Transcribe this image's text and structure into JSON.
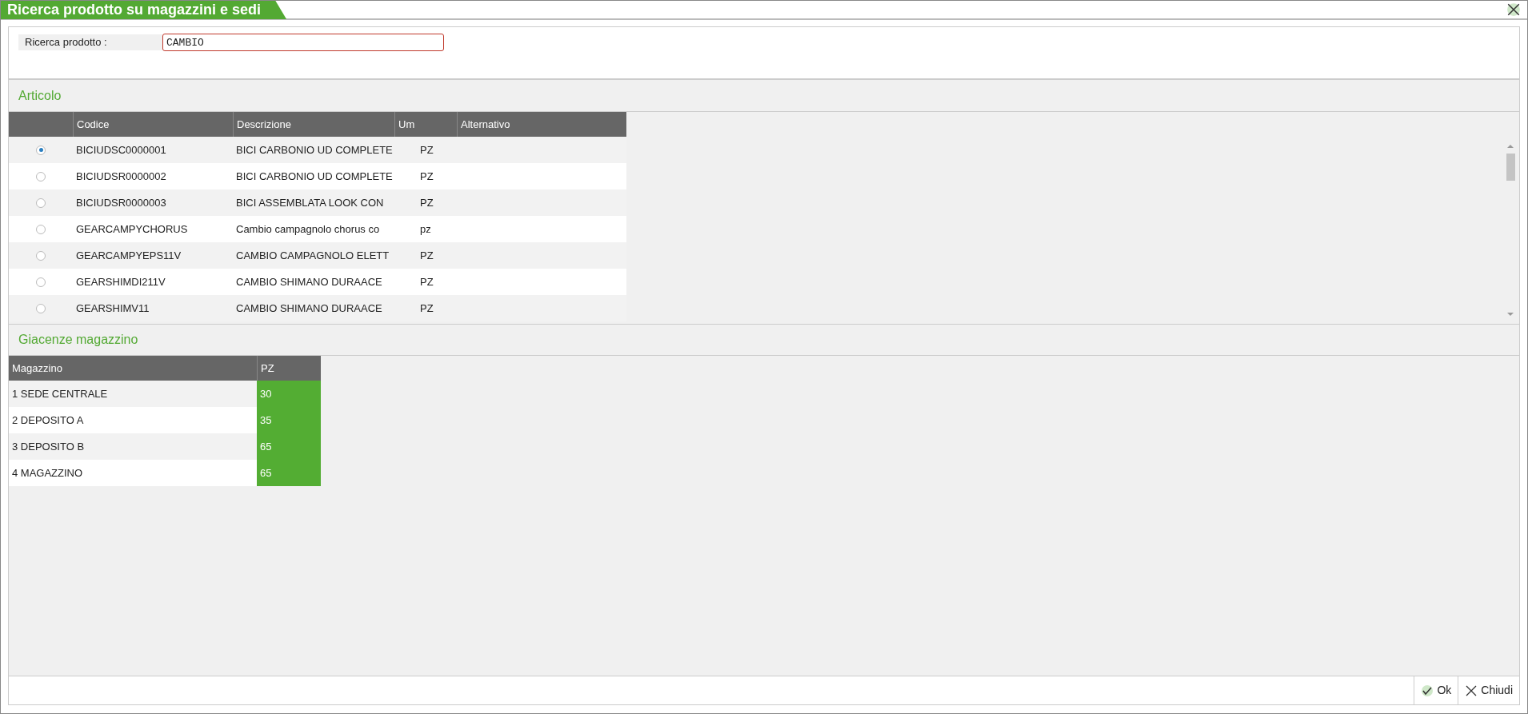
{
  "window": {
    "title": "Ricerca prodotto su magazzini e sedi"
  },
  "search": {
    "label": "Ricerca prodotto :",
    "value": "CAMBIO"
  },
  "articolo": {
    "title": "Articolo",
    "columns": [
      "Codice",
      "Descrizione",
      "Um",
      "Alternativo"
    ],
    "rows": [
      {
        "selected": true,
        "codice": "BICIUDSC0000001",
        "descrizione": "BICI CARBONIO UD COMPLETE",
        "um": "PZ"
      },
      {
        "selected": false,
        "codice": "BICIUDSR0000002",
        "descrizione": "BICI CARBONIO UD COMPLETE",
        "um": "PZ"
      },
      {
        "selected": false,
        "codice": "BICIUDSR0000003",
        "descrizione": "BICI ASSEMBLATA LOOK CON",
        "um": "PZ"
      },
      {
        "selected": false,
        "codice": "GEARCAMPYCHORUS",
        "descrizione": "Cambio campagnolo chorus co",
        "um": "pz"
      },
      {
        "selected": false,
        "codice": "GEARCAMPYEPS11V",
        "descrizione": "CAMBIO CAMPAGNOLO ELETT",
        "um": "PZ"
      },
      {
        "selected": false,
        "codice": "GEARSHIMDI211V",
        "descrizione": "CAMBIO SHIMANO DURAACE",
        "um": "PZ"
      },
      {
        "selected": false,
        "codice": "GEARSHIMV11",
        "descrizione": "CAMBIO SHIMANO DURAACE",
        "um": "PZ"
      }
    ]
  },
  "giacenze": {
    "title": "Giacenze magazzino",
    "columns": [
      "Magazzino",
      "PZ"
    ],
    "rows": [
      {
        "magazzino": "1 SEDE CENTRALE",
        "qty": "30"
      },
      {
        "magazzino": "2 DEPOSITO A",
        "qty": "35"
      },
      {
        "magazzino": "3 DEPOSITO B",
        "qty": "65"
      },
      {
        "magazzino": "4 MAGAZZINO",
        "qty": "65"
      }
    ]
  },
  "buttons": [
    {
      "label": "Ok",
      "kind": "ok"
    },
    {
      "label": "Chiudi",
      "kind": "close"
    }
  ]
}
